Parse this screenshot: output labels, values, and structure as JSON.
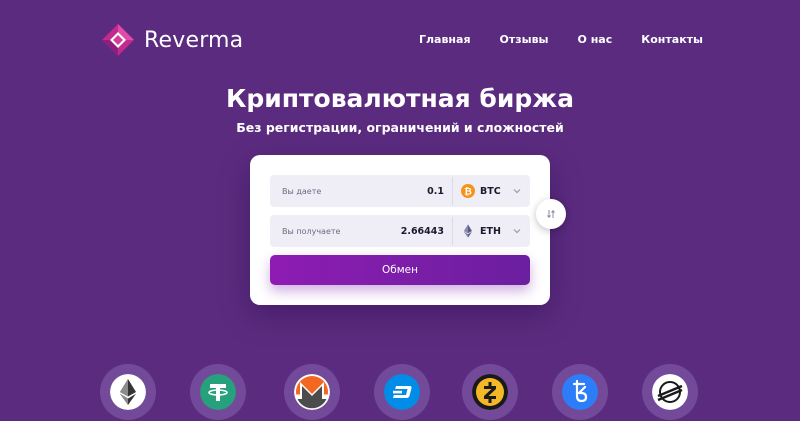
{
  "brand": {
    "name": "Reverma"
  },
  "nav": {
    "items": [
      "Главная",
      "Отзывы",
      "О нас",
      "Контакты"
    ]
  },
  "hero": {
    "title": "Криптовалютная биржа",
    "subtitle": "Без регистрации, ограничений и сложностей"
  },
  "exchange": {
    "give": {
      "label": "Вы даете",
      "value": "0.1",
      "coin": "BTC",
      "icon": "bitcoin-icon"
    },
    "receive": {
      "label": "Вы получаете",
      "value": "2.66443",
      "coin": "ETH",
      "icon": "ethereum-icon"
    },
    "button_label": "Обмен"
  },
  "coins": [
    "ethereum-icon",
    "tether-icon",
    "monero-icon",
    "dash-icon",
    "zcash-icon",
    "tezos-icon",
    "stellar-icon"
  ],
  "colors": {
    "background": "#5b2b7f",
    "accent": "#8e1cb3",
    "bitcoin": "#f7931a",
    "tether": "#26a17b",
    "monero": "#f26822",
    "dash": "#008ce7",
    "zcash": "#f4b728",
    "tezos": "#2c7df7"
  }
}
